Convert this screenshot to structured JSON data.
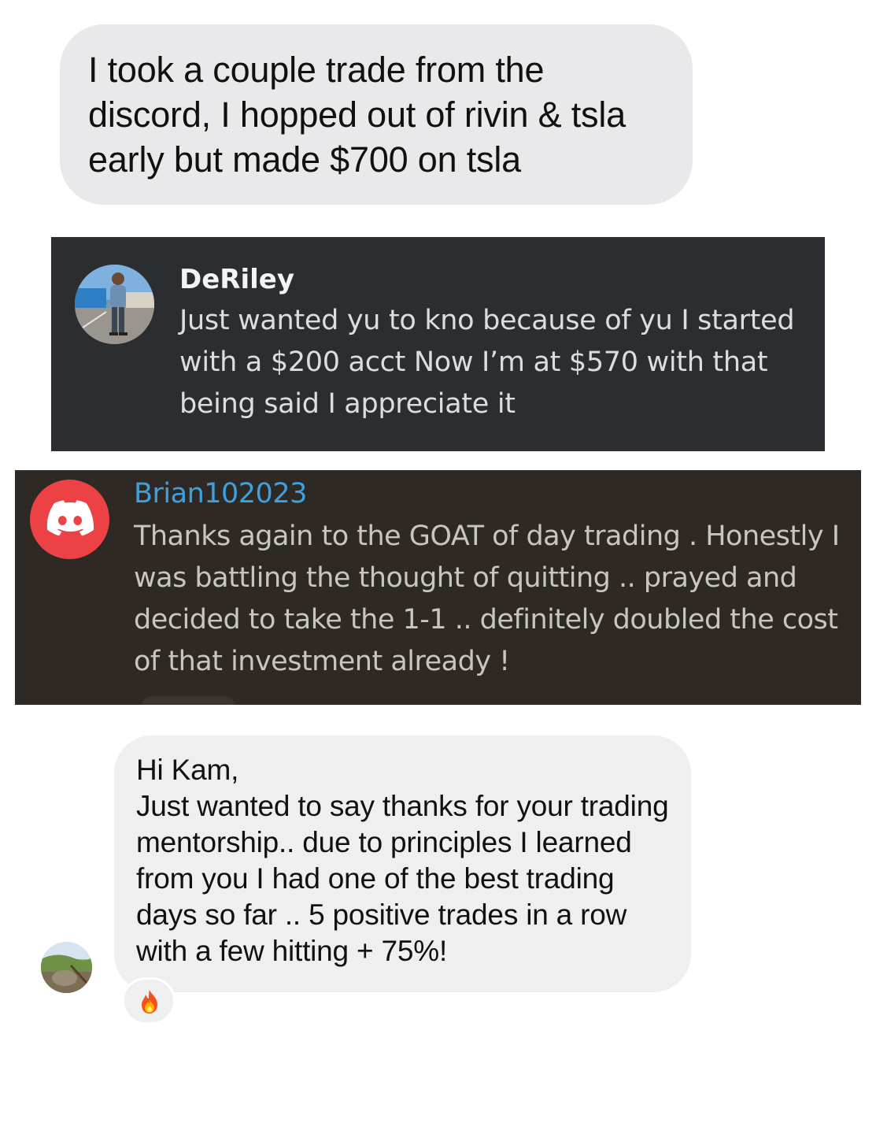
{
  "conversation_1": {
    "message": "I took a couple trade from the discord, I hopped out of rivin & tsla early but made $700 on tsla"
  },
  "conversation_2": {
    "username": "DeRiley",
    "message": "Just wanted yu to kno because of yu I started with a $200 acct Now I’m at $570 with that being said I appreciate it",
    "avatar_icon": "user-photo"
  },
  "conversation_3": {
    "username": "Brian102023",
    "message": "Thanks again to the GOAT of day trading . Honestly I was battling the thought of quitting .. prayed and decided to take the 1-1 .. definitely doubled the cost of that investment already !",
    "avatar_icon": "discord-logo-icon",
    "avatar_color": "#ed4245",
    "username_color": "#3ea0dd"
  },
  "conversation_4": {
    "greeting": "Hi Kam,",
    "message": "Just wanted to say thanks for your trading mentorship.. due to principles I learned from you I had one of the best trading days so far .. 5 positive trades in a row with a few hitting + 75%!",
    "reaction_icon": "fire-emoji-icon",
    "avatar_icon": "user-photo"
  }
}
